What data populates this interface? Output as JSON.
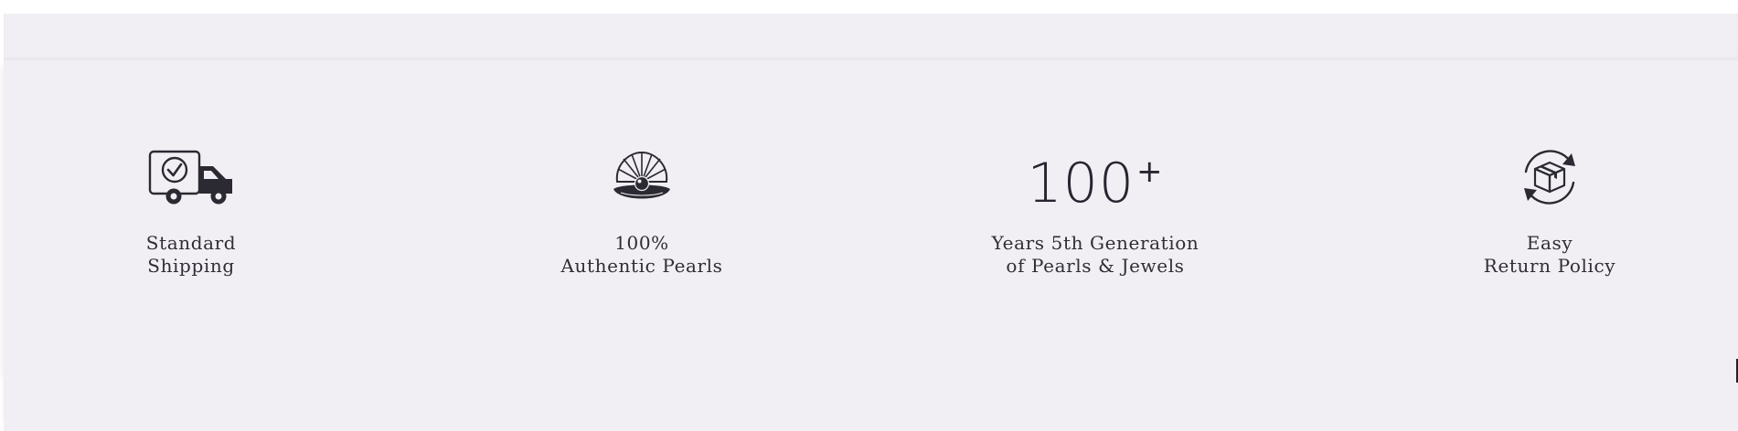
{
  "features": [
    {
      "icon": "delivery-truck-icon",
      "line1": "Standard",
      "line2": "Shipping"
    },
    {
      "icon": "pearl-shell-icon",
      "line1": "100%",
      "line2": "Authentic Pearls"
    },
    {
      "stat_number": "100",
      "stat_suffix": "+",
      "line1": "Years 5th Generation",
      "line2": "of Pearls & Jewels"
    },
    {
      "icon": "return-box-icon",
      "line1": "Easy",
      "line2": "Return Policy"
    }
  ],
  "colors": {
    "background": "#f1eff3",
    "text": "#2f2e36",
    "icon": "#2b2a33"
  }
}
